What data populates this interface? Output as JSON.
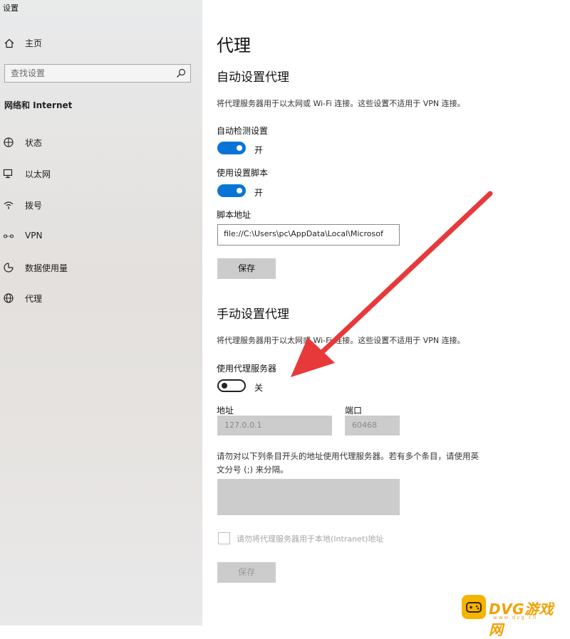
{
  "window": {
    "title": "设置"
  },
  "sidebar": {
    "home_label": "主页",
    "search_placeholder": "查找设置",
    "section_title": "网络和 Internet",
    "items": [
      {
        "label": "状态",
        "icon": "globe-status-icon"
      },
      {
        "label": "以太网",
        "icon": "ethernet-icon"
      },
      {
        "label": "拨号",
        "icon": "dialup-icon"
      },
      {
        "label": "VPN",
        "icon": "vpn-icon"
      },
      {
        "label": "数据使用量",
        "icon": "data-usage-icon"
      },
      {
        "label": "代理",
        "icon": "globe-icon"
      }
    ]
  },
  "main": {
    "title": "代理",
    "auto": {
      "heading": "自动设置代理",
      "description": "将代理服务器用于以太网或 Wi-Fi 连接。这些设置不适用于 VPN 连接。",
      "detect_label": "自动检测设置",
      "detect_state": "开",
      "script_label": "使用设置脚本",
      "script_state": "开",
      "address_label": "脚本地址",
      "address_value": "file://C:\\Users\\pc\\AppData\\Local\\Microsof",
      "save_label": "保存"
    },
    "manual": {
      "heading": "手动设置代理",
      "description": "将代理服务器用于以太网或 Wi-Fi 连接。这些设置不适用于 VPN 连接。",
      "use_proxy_label": "使用代理服务器",
      "use_proxy_state": "关",
      "address_label": "地址",
      "address_value": "127.0.0.1",
      "port_label": "端口",
      "port_value": "60468",
      "exceptions_line1": "请勿对以下列条目开头的地址使用代理服务器。若有多个条目，请使用英",
      "exceptions_line2": "文分号 (;) 来分隔。",
      "exceptions_value": "",
      "local_checkbox_label": "请勿将代理服务器用于本地(Intranet)地址",
      "save_label": "保存"
    }
  },
  "watermark": {
    "text": "DVG游戏网",
    "sub": "www.dvg.cn"
  },
  "colors": {
    "accent": "#0a74d6",
    "annotation_arrow": "#e8393a",
    "watermark": "#f2a100"
  }
}
